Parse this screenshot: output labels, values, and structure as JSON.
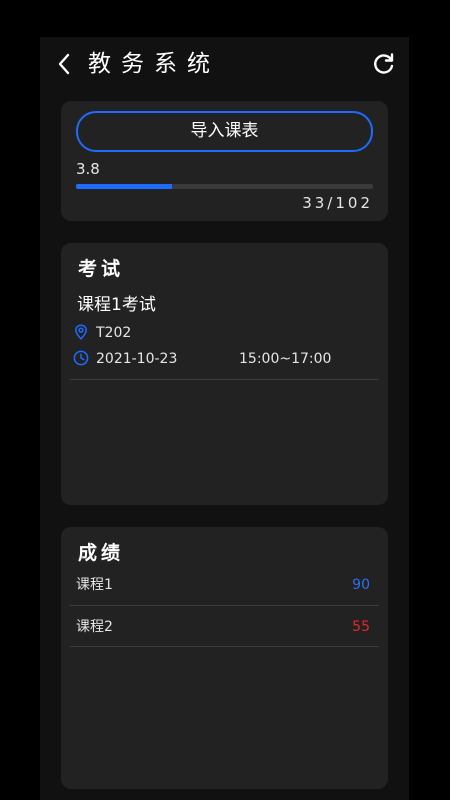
{
  "header": {
    "title": "教务系统",
    "back_icon": "chevron-left-icon",
    "refresh_icon": "refresh-icon"
  },
  "import": {
    "button_label": "导入课表",
    "value": "3.8",
    "progress_fraction": 0.3235,
    "count": "33/102",
    "accent_color": "#1e6bff"
  },
  "exam": {
    "title": "考试",
    "items": [
      {
        "name": "课程1考试",
        "location": "T202",
        "date": "2021-10-23",
        "time": "15:00~17:00"
      }
    ],
    "location_icon": "location-pin-icon",
    "time_icon": "clock-icon"
  },
  "grades": {
    "title": "成绩",
    "items": [
      {
        "course": "课程1",
        "score": "90",
        "color": "#2f6cf7"
      },
      {
        "course": "课程2",
        "score": "55",
        "color": "#e8262a"
      }
    ]
  }
}
